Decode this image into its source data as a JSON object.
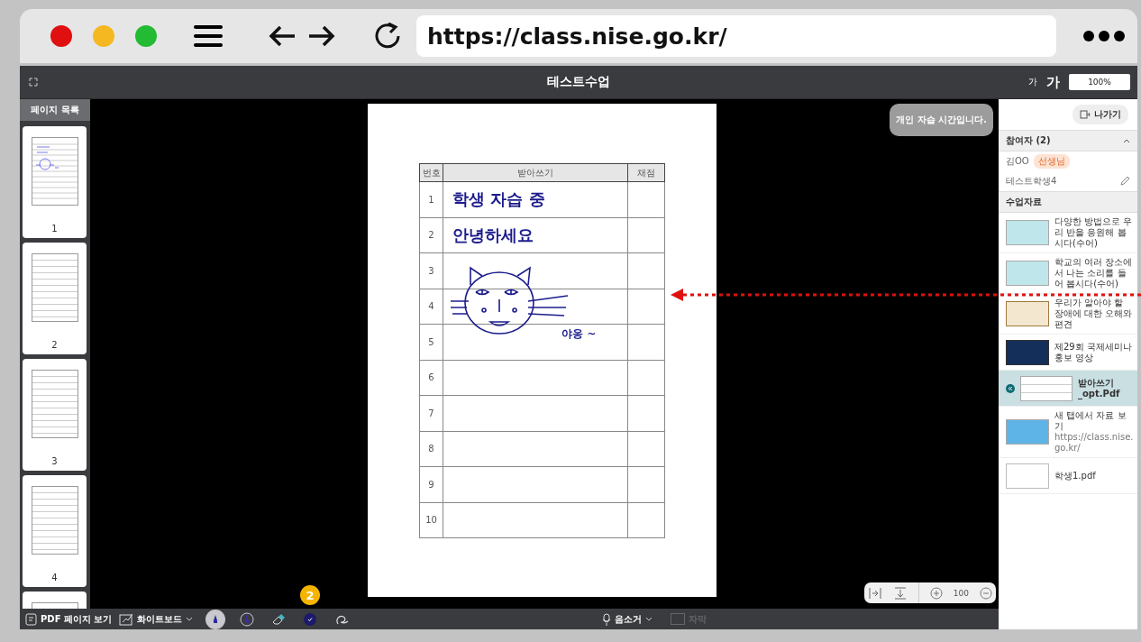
{
  "browser": {
    "url": "https://class.nise.go.kr/"
  },
  "header": {
    "title": "테스트수업",
    "font_small": "가",
    "font_large": "가",
    "zoom_field": "100%"
  },
  "page_list": {
    "title": "페이지 목록",
    "pages": [
      {
        "label": "1",
        "kind": "annotated"
      },
      {
        "label": "2",
        "kind": "blank"
      },
      {
        "label": "3",
        "kind": "blank"
      },
      {
        "label": "4",
        "kind": "blank"
      },
      {
        "kind": "blank"
      }
    ]
  },
  "notice": "개인 자습 시간입니다.",
  "document": {
    "columns": [
      "번호",
      "받아쓰기",
      "채점"
    ],
    "rows": [
      {
        "number": "1",
        "writing": "학생 자습 중"
      },
      {
        "number": "2",
        "writing": "안녕하세요"
      },
      {
        "number": "3"
      },
      {
        "number": "4"
      },
      {
        "number": "5"
      },
      {
        "number": "6"
      },
      {
        "number": "7"
      },
      {
        "number": "8"
      },
      {
        "number": "9"
      },
      {
        "number": "10"
      }
    ],
    "note": "야옹 ~"
  },
  "zoom_controls": {
    "value": "100"
  },
  "side_panel": {
    "exit_button": "나가기",
    "participants": {
      "title": "참여자 (2)",
      "expanded": true,
      "people": [
        {
          "name": "김OO",
          "badge": "선생님",
          "editable": false
        },
        {
          "name": "테스트학생4",
          "editable": true
        }
      ]
    },
    "materials": {
      "title": "수업자료",
      "items": [
        {
          "title": "다양한 방법으로 우리 반을 응원해 봅시다(수어)",
          "kind": "video",
          "selected": false
        },
        {
          "title": "학교의 여러 장소에서 나는 소리를 들어 봅시다(수어)",
          "kind": "video",
          "selected": false
        },
        {
          "title": "우리가 알아야 할 장애에 대한 오해와 편견",
          "kind": "poster",
          "selected": false
        },
        {
          "title": "제29회 국제세미나 홍보 영상",
          "kind": "dark",
          "selected": false
        },
        {
          "title": "받아쓰기_opt.Pdf",
          "kind": "pdf",
          "selected": true
        },
        {
          "title": "새 탭에서 자료 보기",
          "subtitle": "https://class.nise.go.kr/",
          "kind": "link",
          "selected": false
        },
        {
          "title": "학생1.pdf",
          "kind": "blank",
          "selected": false
        }
      ]
    }
  },
  "toolbar": {
    "pdf_view": "PDF 페이지 보기",
    "whiteboard": "화이트보드",
    "tools": [
      {
        "kind": "pen",
        "selected": true
      },
      {
        "kind": "marker",
        "selected": false
      },
      {
        "kind": "eraser",
        "selected": false
      },
      {
        "kind": "color",
        "color": "#1b1a6b",
        "selected": false,
        "badge": "2"
      },
      {
        "kind": "lasso",
        "selected": false
      }
    ],
    "mute": "음소거",
    "captions": {
      "label": "자막",
      "disabled": true
    }
  }
}
